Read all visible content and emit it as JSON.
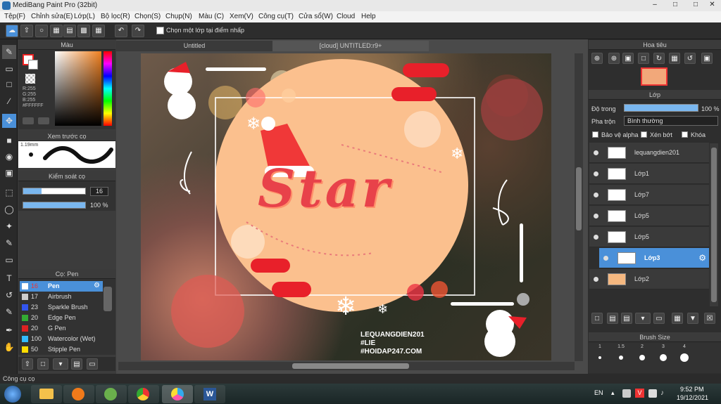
{
  "window": {
    "title": "MediBang Paint Pro (32bit)"
  },
  "menu": [
    "Tệp(F)",
    "Chỉnh sửa(E)",
    "Lớp(L)",
    "Bộ lọc(R)",
    "Chọn(S)",
    "Chụp(N)",
    "Màu (C)",
    "Xem(V)",
    "Công cụ(T)",
    "Cửa sổ(W)",
    "Cloud",
    "Help"
  ],
  "toolbar": {
    "checkbox_label": "Chọn một lớp tại điểm nhấp"
  },
  "color_panel": {
    "title": "Màu",
    "r": "R:255",
    "g": "G:255",
    "b": "B:255",
    "hex": "#FFFFFF"
  },
  "preview_panel": {
    "title": "Xem trước cọ",
    "size": "1.19mm"
  },
  "brush_control": {
    "title": "Kiểm soát cọ",
    "size": "16",
    "opacity": "100 %"
  },
  "brush_panel": {
    "title": "Cọ: Pen",
    "items": [
      {
        "size": "16",
        "name": "Pen",
        "color": "#ffffff"
      },
      {
        "size": "17",
        "name": "Airbrush",
        "color": "#cccccc"
      },
      {
        "size": "23",
        "name": "Sparkle Brush",
        "color": "#3355ee"
      },
      {
        "size": "20",
        "name": "Edge Pen",
        "color": "#33aa33"
      },
      {
        "size": "20",
        "name": "G Pen",
        "color": "#dd2222"
      },
      {
        "size": "100",
        "name": "Watercolor (Wet)",
        "color": "#33bbff"
      },
      {
        "size": "50",
        "name": "Stipple Pen",
        "color": "#ffdd00"
      }
    ]
  },
  "tabs": {
    "tab1": "Untitled",
    "tab2": "[cloud] UNTITLED:r9+"
  },
  "artwork": {
    "title": "Star",
    "credits": [
      "LEQUANGDIEN201",
      "#LIE",
      "#HOIDAP247.COM"
    ]
  },
  "navigator": {
    "title": "Hoa tiêu"
  },
  "layers_panel": {
    "title": "Lớp",
    "opacity_label": "Độ trong",
    "opacity_value": "100 %",
    "blend_label": "Pha trộn",
    "blend_value": "Bình thường",
    "protect_alpha": "Bảo vệ alpha",
    "clipping": "Xén bớt",
    "lock": "Khóa",
    "layers": [
      "lequangdien201",
      "Lớp1",
      "Lớp7",
      "Lớp5",
      "Lớp5",
      "Lớp3",
      "Lớp2"
    ],
    "selected_index": 5
  },
  "brush_size_panel": {
    "title": "Brush Size",
    "sizes": [
      "1",
      "1.5",
      "2",
      "3",
      "4"
    ]
  },
  "status": {
    "text": "Công cụ cọ"
  },
  "taskbar": {
    "lang": "EN",
    "time": "9:52 PM",
    "date": "19/12/2021"
  },
  "colors": {
    "accent": "#4a90d9",
    "circle": "#fbc08e",
    "title_text": "#e8424a"
  }
}
